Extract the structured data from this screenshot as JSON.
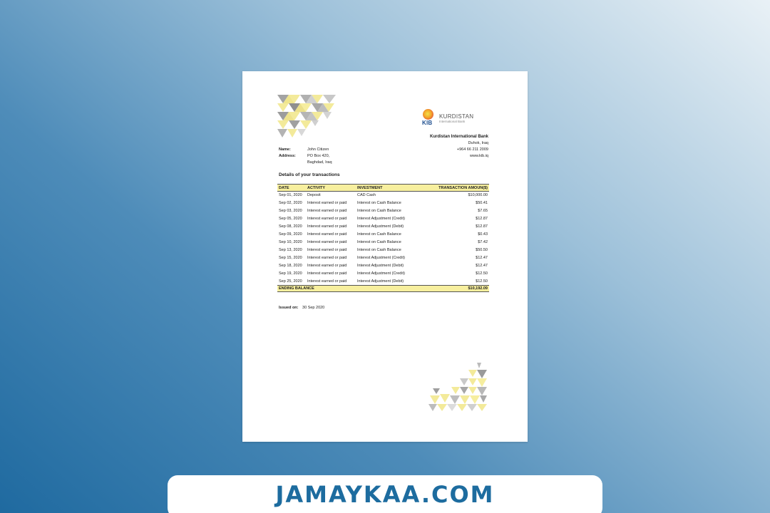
{
  "bank": {
    "logo_mark": "KIB",
    "logo_name": "KURDISTAN",
    "logo_subtitle": "International Bank",
    "name": "Kurdistan International Bank",
    "city": "Duhok, Iraq",
    "phone": "+964 66 211 2009",
    "website": "www.kib.iq"
  },
  "customer": {
    "name_label": "Name:",
    "name": "John Citizen",
    "address_label": "Address:",
    "address_line1": "PO Box 420,",
    "address_line2": "Baghdad, Iraq"
  },
  "section_title": "Details of your transactions",
  "table": {
    "headers": [
      "DATE",
      "ACTIVITY",
      "INVESTMENT",
      "TRANSACTION AMOUN($)"
    ],
    "rows": [
      {
        "date": "Sep 01, 2020",
        "activity": "Deposit",
        "investment": "CAD Cash",
        "amount": "$10,000.00"
      },
      {
        "date": "Sep 02, 2020",
        "activity": "Interest earned or paid",
        "investment": "Interest on Cash Balance",
        "amount": "$50.41"
      },
      {
        "date": "Sep 03, 2020",
        "activity": "Interest earned or paid",
        "investment": "Interest on Cash Balance",
        "amount": "$7.65"
      },
      {
        "date": "Sep 05, 2020",
        "activity": "Interest earned or paid",
        "investment": "Interest Adjustment (Credit)",
        "amount": "$12.87"
      },
      {
        "date": "Sep 08, 2020",
        "activity": "Interest earned or paid",
        "investment": "Interest Adjustment (Debit)",
        "amount": "$12.87"
      },
      {
        "date": "Sep 09, 2020",
        "activity": "Interest earned or paid",
        "investment": "Interest on Cash Balance",
        "amount": "$0.43"
      },
      {
        "date": "Sep 10, 2020",
        "activity": "Interest earned or paid",
        "investment": "Interest on Cash Balance",
        "amount": "$7.42"
      },
      {
        "date": "Sep 13, 2020",
        "activity": "Interest earned or paid",
        "investment": "Interest on Cash Balance",
        "amount": "$50.50"
      },
      {
        "date": "Sep 15, 2020",
        "activity": "Interest earned or paid",
        "investment": "Interest Adjustment (Credit)",
        "amount": "$12.47"
      },
      {
        "date": "Sep 18, 2020",
        "activity": "Interest earned or paid",
        "investment": "Interest Adjustment (Debit)",
        "amount": "$12.47"
      },
      {
        "date": "Sep 19, 2020",
        "activity": "Interest earned or paid",
        "investment": "Interest Adjustment (Credit)",
        "amount": "$12.50"
      },
      {
        "date": "Sep 25, 2020",
        "activity": "Interest earned or paid",
        "investment": "Interest Adjustment (Debit)",
        "amount": "$12.50"
      }
    ],
    "ending_label": "ENDING BALANCE",
    "ending_amount": "$10,192.09"
  },
  "issued": {
    "label": "Issued on:",
    "date": "30 Sep 2020"
  },
  "watermark": "JAMAYKAA.COM",
  "colors": {
    "highlight": "#f7ef9e",
    "pattern_yellow": "#f3ea9a",
    "pattern_gray": "#9a9a9a",
    "brand_blue": "#1d6c9f"
  }
}
